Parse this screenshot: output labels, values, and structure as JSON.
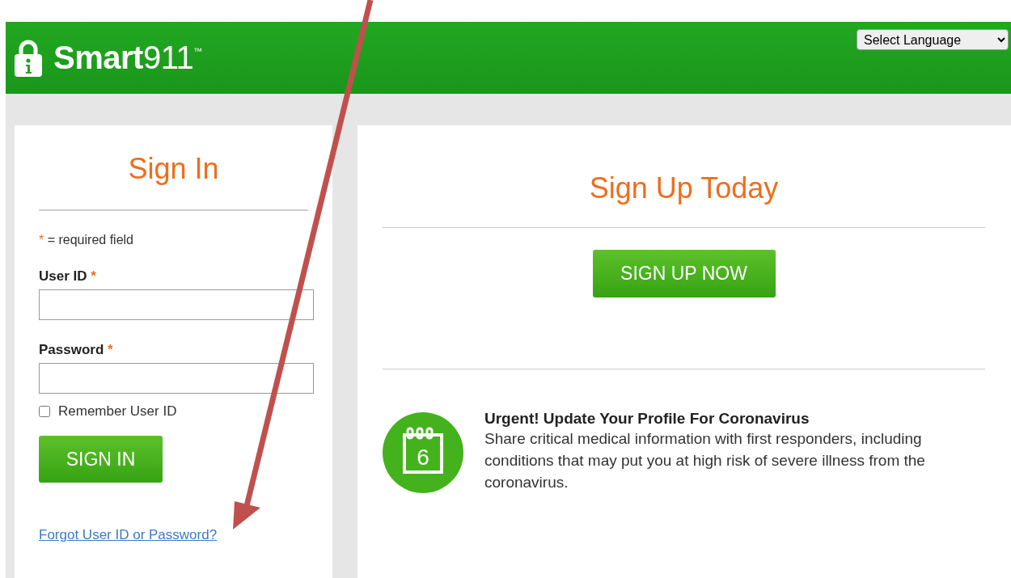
{
  "header": {
    "logo": "**Smart**911$^{™}$",
    "language_select": {
      "value": "Select Language"
    }
  },
  "sign_in": {
    "title": "Sign In",
    "required_note": "= required field",
    "required_mark": "*",
    "fields": [
      {
        "label": "User ID",
        "required": true
      },
      {
        "label": "Password",
        "required": true
      }
    ],
    "remember": {
      "label": "Remember User ID",
      "checked": false
    },
    "button": "SIGN IN",
    "forgot_link": "Forgot User ID or Password?"
  },
  "sign_up": {
    "title": "Sign Up Today",
    "button": "SIGN UP NOW",
    "notice": {
      "icon_day": "6",
      "title": "Urgent! Update Your Profile For Coronavirus",
      "text": "Share critical medical information with first responders, including conditions that may put you at high risk of severe illness from the coronavirus."
    }
  },
  "annotation": {
    "kind": "arrow"
  }
}
